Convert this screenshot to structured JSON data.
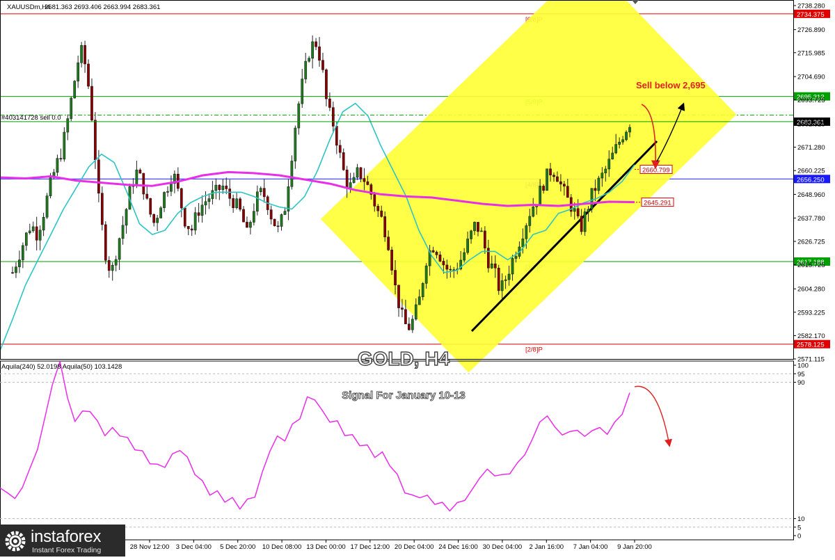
{
  "header": {
    "symbol": "XAUUSDm,H4",
    "ohlc": "2681.363 2693.406 2663.994 2683.361",
    "order_label": "#403141728 sell 0.0"
  },
  "title": "GOLD, H4",
  "subtitle": "Signal For January 10-13",
  "annotation": "Sell below 2,695",
  "logo": {
    "name": "instaforex",
    "tagline": "Instant Forex Trading"
  },
  "colors": {
    "candle_up": "#1f7a1f",
    "candle_down": "#8b0000",
    "ema_fast": "#2ec4c4",
    "ma_slow": "#e82ee8",
    "channel": "#ffff33",
    "murray_red": "#e00000",
    "murray_green": "#00a000",
    "indicator_line": "#e82ee8",
    "arrow_red": "#e02020"
  },
  "chart_data": [
    {
      "type": "candlestick",
      "symbol": "XAUUSDm",
      "timeframe": "H4",
      "ylim": [
        2571.115,
        2738.28
      ],
      "y_ticks": [
        "2738.280",
        "2726.890",
        "2715.985",
        "2704.690",
        "2693.725",
        "2682.325",
        "2671.280",
        "2660.225",
        "2648.960",
        "2637.780",
        "2626.725",
        "2615.725",
        "2604.280",
        "2593.225",
        "2582.170",
        "2571.115"
      ],
      "x_ticks": [
        "28 Nov 12:00",
        "3 Dec 04:00",
        "5 Dec 20:00",
        "10 Dec 08:00",
        "13 Dec 00:00",
        "17 Dec 12:00",
        "20 Dec 04:00",
        "24 Dec 16:00",
        "30 Dec 04:00",
        "2 Jan 16:00",
        "7 Jan 04:00",
        "9 Jan 20:00"
      ],
      "candle_path": [
        2612,
        2620,
        2628,
        2635,
        2630,
        2640,
        2652,
        2662,
        2670,
        2685,
        2702,
        2718,
        2708,
        2682,
        2645,
        2622,
        2611,
        2625,
        2636,
        2650,
        2660,
        2655,
        2642,
        2635,
        2645,
        2652,
        2660,
        2648,
        2636,
        2632,
        2641,
        2645,
        2648,
        2650,
        2653,
        2648,
        2645,
        2640,
        2630,
        2642,
        2650,
        2648,
        2638,
        2632,
        2640,
        2662,
        2686,
        2702,
        2716,
        2722,
        2712,
        2690,
        2682,
        2668,
        2655,
        2652,
        2660,
        2656,
        2650,
        2642,
        2636,
        2625,
        2605,
        2592,
        2585,
        2590,
        2600,
        2618,
        2625,
        2622,
        2615,
        2612,
        2615,
        2620,
        2628,
        2635,
        2630,
        2618,
        2613,
        2603,
        2610,
        2618,
        2626,
        2634,
        2642,
        2647,
        2654,
        2660,
        2660,
        2652,
        2646,
        2641,
        2632,
        2641,
        2650,
        2655,
        2660,
        2666,
        2672,
        2678,
        2683
      ],
      "ema_fast_path": [
        2575,
        2590,
        2606,
        2618,
        2630,
        2642,
        2652,
        2662,
        2668,
        2664,
        2650,
        2635,
        2630,
        2632,
        2640,
        2645,
        2648,
        2650,
        2650,
        2650,
        2648,
        2645,
        2643,
        2642,
        2648,
        2660,
        2675,
        2688,
        2692,
        2686,
        2672,
        2660,
        2648,
        2632,
        2620,
        2612,
        2613,
        2618,
        2622,
        2622,
        2618,
        2622,
        2630,
        2632,
        2640,
        2642,
        2645,
        2647,
        2650,
        2655,
        2663
      ],
      "ma_slow_path": [
        2657,
        2656.5,
        2657.5,
        2655.5,
        2654.5,
        2653.5,
        2653,
        2655,
        2658,
        2659.5,
        2659,
        2658,
        2656,
        2654,
        2651,
        2649,
        2648,
        2647.5,
        2646,
        2644.5,
        2643.5,
        2644,
        2643.5,
        2644.5,
        2645.5,
        2645.3
      ],
      "levels": [
        {
          "label": "[6/8]P",
          "value": 2734.375,
          "tag": "2734.375",
          "color": "#e00000"
        },
        {
          "label": "[5/8]P",
          "value": 2695.312,
          "tag": "2695.312",
          "color": "#00a000"
        },
        {
          "label": "[4/8]P",
          "value": 2656.25,
          "tag": "2656.250",
          "color": "#1a1aff"
        },
        {
          "label": "[3/8]P",
          "value": 2617.188,
          "tag": "2617.188",
          "color": "#00a000"
        },
        {
          "label": "[2/8]P",
          "value": 2578.125,
          "tag": "2578.125",
          "color": "#e00000"
        }
      ],
      "price_tags": [
        {
          "value": 2683.361,
          "tag": "2683.361",
          "kind": "current"
        },
        {
          "value": 2660.799,
          "tag": "2660.799",
          "kind": "target"
        },
        {
          "value": 2645.291,
          "tag": "2645.291",
          "kind": "ma"
        }
      ],
      "channel": {
        "from": [
          "20 Dec 04:00",
          2601
        ],
        "to": [
          "9 Jan 20:00",
          2708
        ],
        "half_width": 24
      }
    },
    {
      "type": "line",
      "name": "Aquila",
      "legend": "Aquila(240) 52.0198   Aquila(50) 103.1428",
      "ylim": [
        0,
        100
      ],
      "y_ticks": [
        "100",
        "95",
        "90",
        "10",
        "5",
        "0"
      ],
      "values": [
        28,
        25,
        22,
        28,
        40,
        50,
        70,
        88,
        103,
        80,
        68,
        72,
        74,
        66,
        60,
        62,
        60,
        56,
        52,
        48,
        44,
        40,
        42,
        46,
        52,
        44,
        38,
        30,
        26,
        24,
        22,
        20,
        18,
        19,
        25,
        35,
        52,
        56,
        58,
        63,
        71,
        79,
        82,
        71,
        69,
        65,
        61,
        57,
        55,
        51,
        48,
        47,
        43,
        34,
        27,
        22,
        24,
        22,
        20,
        18,
        16,
        18,
        22,
        26,
        35,
        38,
        36,
        35,
        37,
        42,
        48,
        56,
        67,
        70,
        64,
        59,
        61,
        62,
        58,
        62,
        63,
        60,
        66,
        72,
        83
      ]
    }
  ]
}
